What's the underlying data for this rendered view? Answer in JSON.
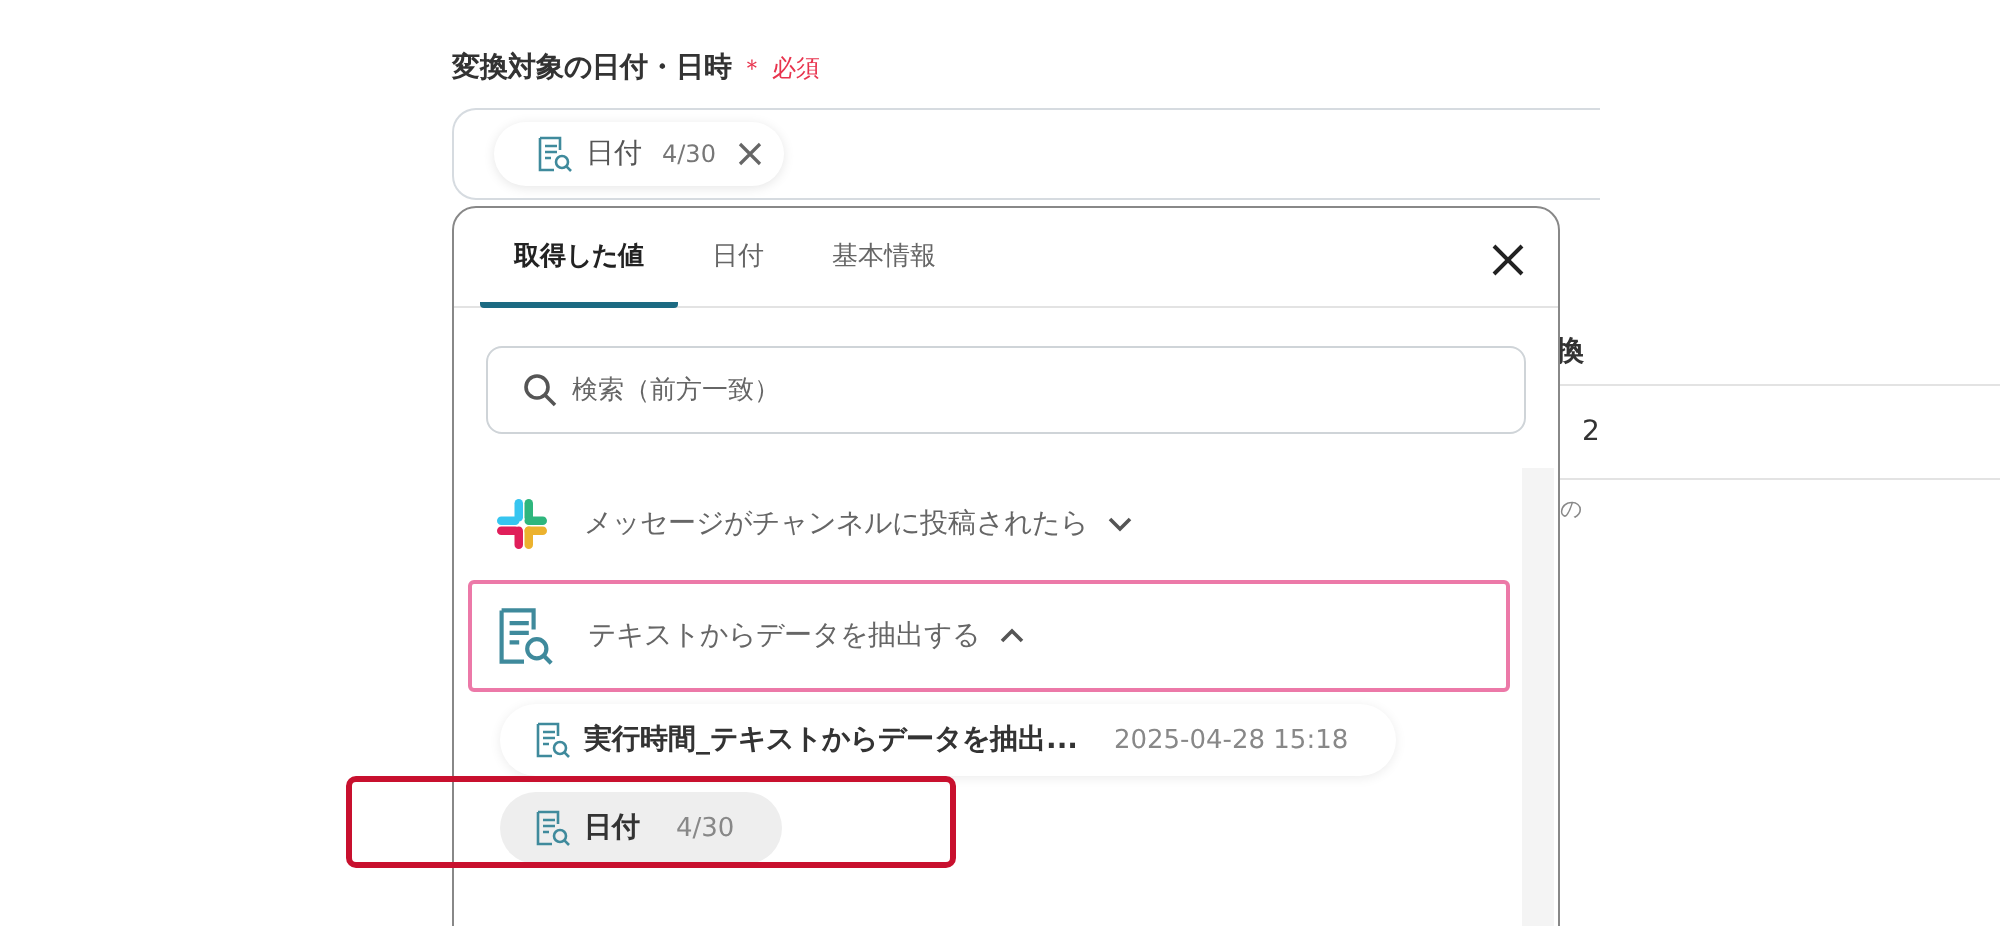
{
  "field": {
    "label": "変換対象の日付・日時",
    "required_mark": "＊",
    "required_text": "必須",
    "chips": [
      {
        "name": "日付",
        "value": "4/30"
      }
    ]
  },
  "background_fragments": [
    "換",
    "2",
    "の"
  ],
  "popup": {
    "tabs": [
      {
        "label": "取得した値",
        "selected": true
      },
      {
        "label": "日付",
        "selected": false
      },
      {
        "label": "基本情報",
        "selected": false
      }
    ],
    "search": {
      "placeholder": "検索（前方一致）"
    },
    "groups": [
      {
        "title": "メッセージがチャンネルに投稿されたら",
        "kind": "slack",
        "expanded": false,
        "selected": false
      },
      {
        "title": "テキストからデータを抽出する",
        "kind": "document",
        "expanded": true,
        "selected": true,
        "items": [
          {
            "name": "実行時間_テキストからデータを抽出...",
            "value": "2025-04-28 15:18",
            "hovered": false,
            "highlighted": false
          },
          {
            "name": "日付",
            "value": "4/30",
            "hovered": true,
            "highlighted": true
          }
        ]
      }
    ]
  }
}
